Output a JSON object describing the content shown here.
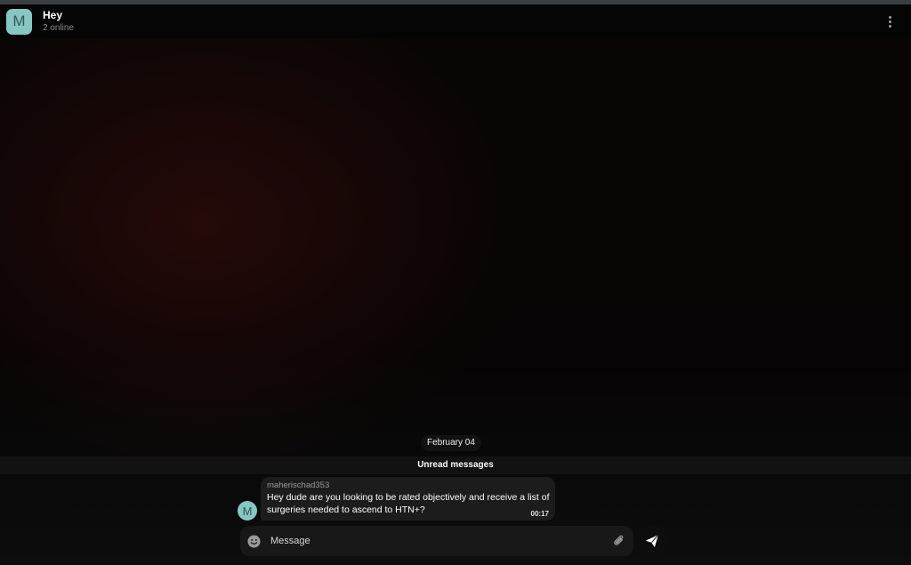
{
  "chat": {
    "avatar_letter": "M",
    "title": "Hey",
    "status": "2 online"
  },
  "icons": {
    "menu": "more-vertical-icon",
    "emoji": "smile-icon",
    "attach": "paperclip-icon",
    "send": "paper-plane-icon"
  },
  "colors": {
    "avatar": "#88c6c4",
    "bubble": "#1c1c1c",
    "background": "#000000"
  },
  "timeline": {
    "date_label": "February 04",
    "unread_label": "Unread messages"
  },
  "messages": [
    {
      "avatar_letter": "M",
      "author": "maherischad353",
      "text": "Hey dude are you looking to be rated objectively and receive a list of surgeries needed to ascend to HTN+?",
      "time": "00:17"
    }
  ],
  "composer": {
    "placeholder": "Message"
  }
}
